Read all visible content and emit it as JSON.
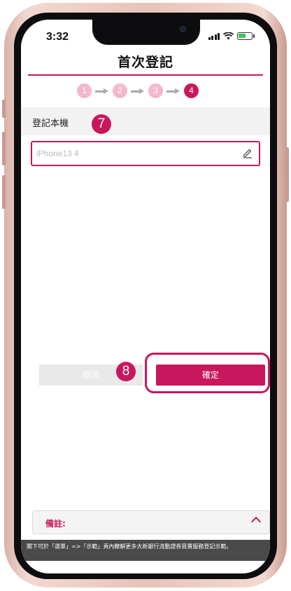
{
  "status_bar": {
    "time": "3:32"
  },
  "header": {
    "title": "首次登記"
  },
  "stepper": {
    "steps": [
      "1",
      "2",
      "3",
      "4"
    ],
    "active_step": 4
  },
  "form": {
    "section_label": "登記本機",
    "device_name_placeholder": "iPhone13 4",
    "cancel_label": "取消",
    "confirm_label": "確定"
  },
  "annotations": {
    "badge_7": "7",
    "badge_8": "8"
  },
  "notes": {
    "label": "備註:"
  },
  "footer": {
    "text": "閣下可於「選單」=>「示範」頁內瞭解更多大新銀行流動證券買賣服務登記示範。"
  },
  "icons": {
    "edit": "pencil-icon",
    "expand": "chevron-up-icon",
    "step_arrow": "arrow-right-icon",
    "wifi": "wifi-icon",
    "battery": "battery-charging-icon",
    "signal": "cellular-signal-icon"
  },
  "colors": {
    "accent": "#c8175d",
    "step_inactive": "#f3b8cb",
    "cancel_bg": "#e9e9e9",
    "footer_bg": "#4a4a4a"
  }
}
